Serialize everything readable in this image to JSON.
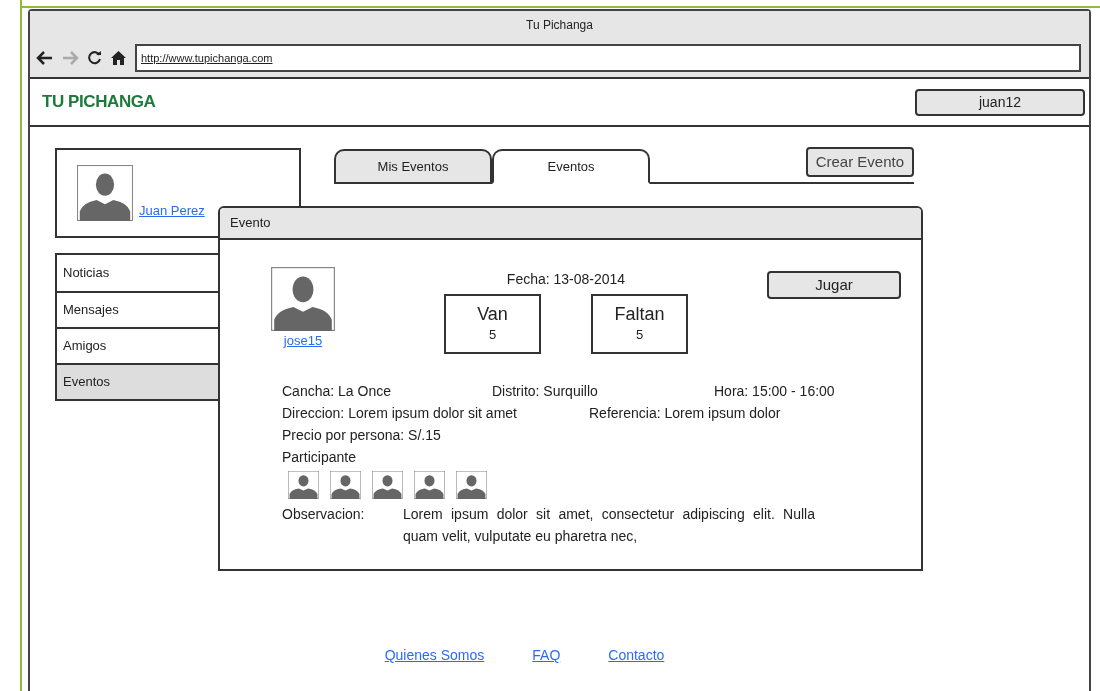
{
  "window": {
    "title": "Tu Pichanga",
    "url": "http://www.tupichanga.com"
  },
  "header": {
    "logo": "TU PICHANGA",
    "user_button": "juan12"
  },
  "profile": {
    "name": "Juan Perez"
  },
  "sidebar": {
    "items": [
      {
        "label": "Noticias",
        "selected": false
      },
      {
        "label": "Mensajes",
        "selected": false
      },
      {
        "label": "Amigos",
        "selected": false
      },
      {
        "label": "Eventos",
        "selected": true
      }
    ]
  },
  "tabs": [
    {
      "label": "Mis Eventos",
      "selected": false
    },
    {
      "label": "Eventos",
      "selected": true
    }
  ],
  "create_button": "Crear Evento",
  "dialog": {
    "title": "Evento",
    "organizer": "jose15",
    "date": "Fecha: 13-08-2014",
    "play_button": "Jugar",
    "counters": [
      {
        "label": "Van",
        "value": "5"
      },
      {
        "label": "Faltan",
        "value": "5"
      }
    ],
    "details_row_1": [
      "Cancha: La Once",
      "Distrito: Surquillo",
      "Hora: 15:00 - 16:00"
    ],
    "details_row_2": [
      "Direccion: Lorem ipsum dolor sit amet",
      "Referencia: Lorem ipsum dolor"
    ],
    "price": "Precio por persona: S/.15",
    "participants_label": "Participante",
    "observation_label": "Observacion:",
    "observation": "Lorem ipsum dolor sit amet, consectetur adipiscing elit. Nulla quam velit, vulputate eu pharetra nec,"
  },
  "footer": {
    "links": [
      "Quienes Somos",
      "FAQ",
      "Contacto"
    ]
  }
}
